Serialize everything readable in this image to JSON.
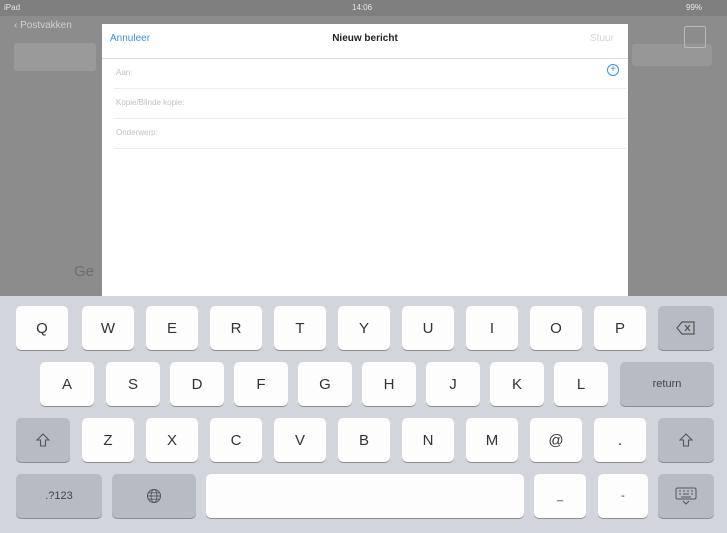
{
  "status_bar": {
    "carrier": "iPad",
    "time": "14:06",
    "battery": "99%"
  },
  "background_app": {
    "back_label": "Postvakken",
    "partial_text": "Ge"
  },
  "compose": {
    "cancel_label": "Annuleer",
    "title": "Nieuw bericht",
    "send_label": "Stuur",
    "to_label": "Aan:",
    "cc_bcc_label": "Kopie/Blinde kopie:",
    "subject_label": "Onderwerp:",
    "add_contact_symbol": "+"
  },
  "keyboard": {
    "row1": [
      "Q",
      "W",
      "E",
      "R",
      "T",
      "Y",
      "U",
      "I",
      "O",
      "P"
    ],
    "row2": [
      "A",
      "S",
      "D",
      "F",
      "G",
      "H",
      "J",
      "K",
      "L"
    ],
    "row3": [
      "Z",
      "X",
      "C",
      "V",
      "B",
      "N",
      "M",
      "@",
      "."
    ],
    "return_label": "return",
    "numbers_label": ".?123",
    "underscore": "_",
    "dash": "-"
  }
}
